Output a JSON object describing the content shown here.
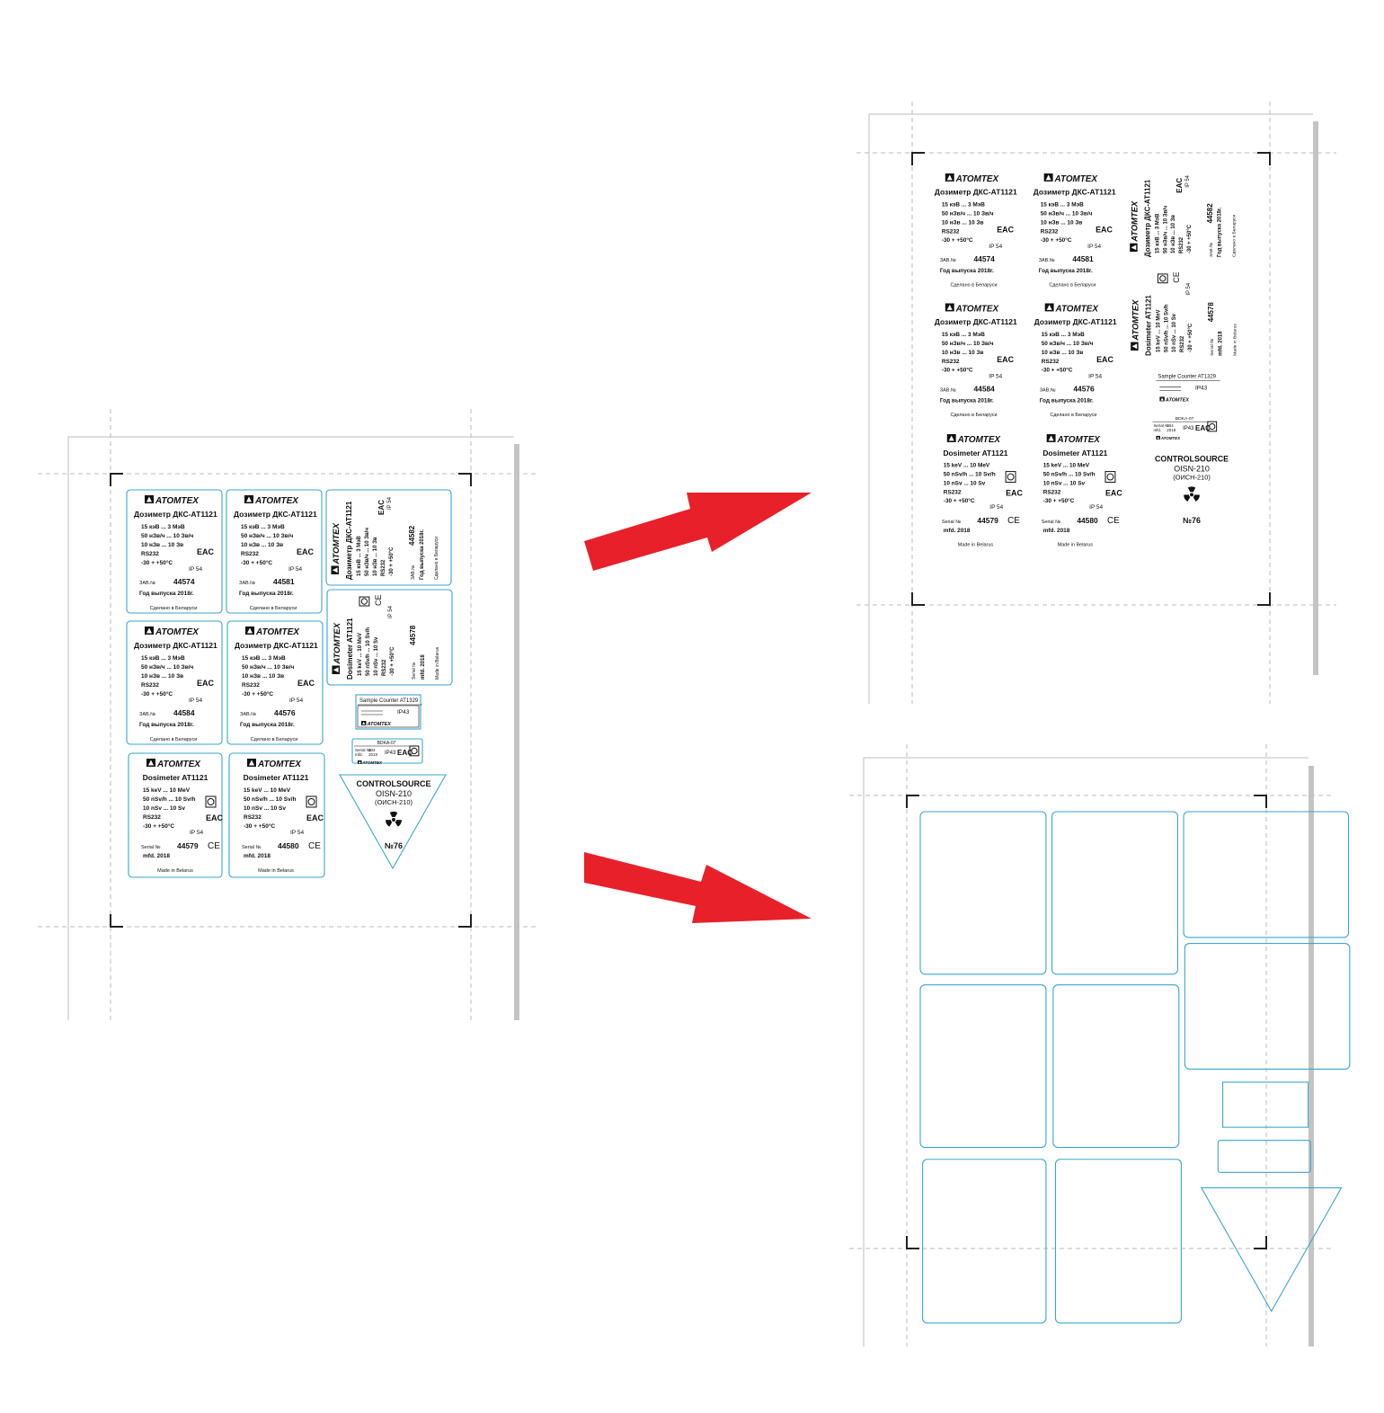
{
  "colors": {
    "label_outline": "#3aa6cc",
    "arrow": "#e8202a",
    "guide": "#b8b8b8",
    "sheet_shadow": "#c4c4c4"
  },
  "labels": {
    "brand": "ATOMTEX",
    "rus_title": "Дозиметр ДКС-АТ1121",
    "rus_lines": [
      "15 кэВ ... 3 МэВ",
      "50 нЗв/ч ... 10 Зв/ч",
      "10 нЗв ... 10 Зв",
      "RS232",
      "-30 + +50°C"
    ],
    "ip54": "IP 54",
    "zav_label": "ЗАВ.№",
    "year_line": "Год выпуска 2018г.",
    "made_ru": "Сделано в Беларуси",
    "eng_title": "Dosimeter AT1121",
    "eng_lines": [
      "15 keV ... 10 MeV",
      "50 nSv/h ... 10 Sv/h",
      "10 nSv ... 10 Sv",
      "RS232",
      "-30 + +50°C"
    ],
    "serial_label": "Serial №",
    "mfd": "mfd. 2018",
    "made_en": "Made in Belarus",
    "serials_ru": [
      "44574",
      "44581",
      "44584",
      "44576"
    ],
    "serials_rot": [
      "44582",
      "44578"
    ],
    "serials_en": [
      "44579",
      "44580"
    ],
    "counter_title": "Sample Counter AT1329",
    "counter_ip": "IP43",
    "bdka_title": "BDKA-07",
    "bdka_serial": "Serial №",
    "bdka_serial_val": "004",
    "bdka_mfd": "mfd.",
    "bdka_year": "2018",
    "bdka_ip": "IP43",
    "source_title": "CONTROLSOURCE",
    "source_model": "OISN-210",
    "source_model_ru": "(ОИСН-210)",
    "source_number": "№76",
    "eac_mark": "EAC",
    "ce_mark": "CE"
  }
}
